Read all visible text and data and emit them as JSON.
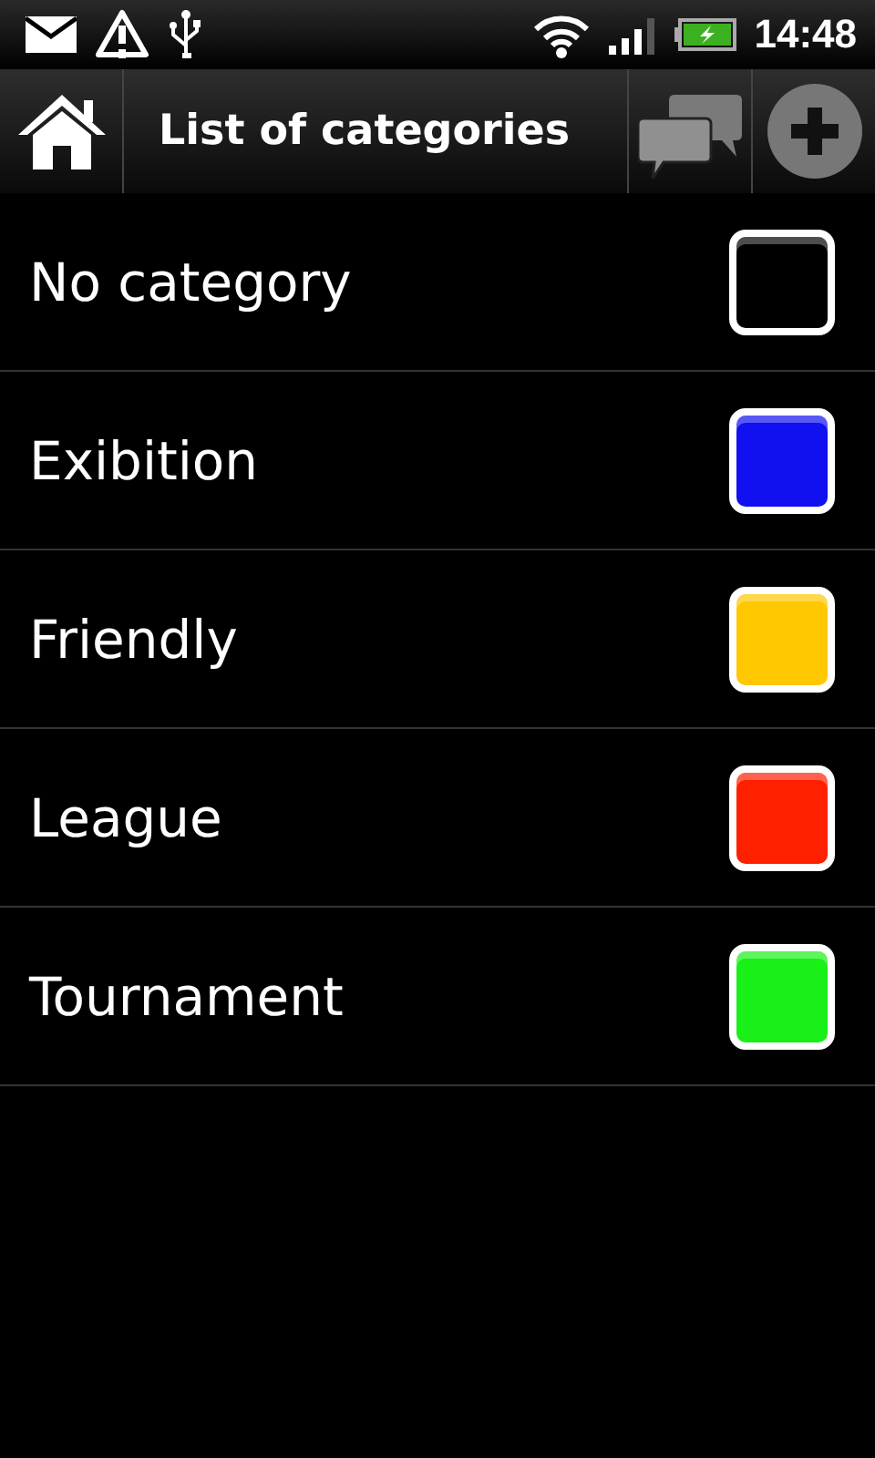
{
  "status_bar": {
    "time": "14:48"
  },
  "action_bar": {
    "title": "List of categories"
  },
  "categories": [
    {
      "name": "No category",
      "color": "#000000"
    },
    {
      "name": "Exibition",
      "color": "#1010f0"
    },
    {
      "name": "Friendly",
      "color": "#ffc800"
    },
    {
      "name": "League",
      "color": "#ff2000"
    },
    {
      "name": "Tournament",
      "color": "#18f018"
    }
  ]
}
